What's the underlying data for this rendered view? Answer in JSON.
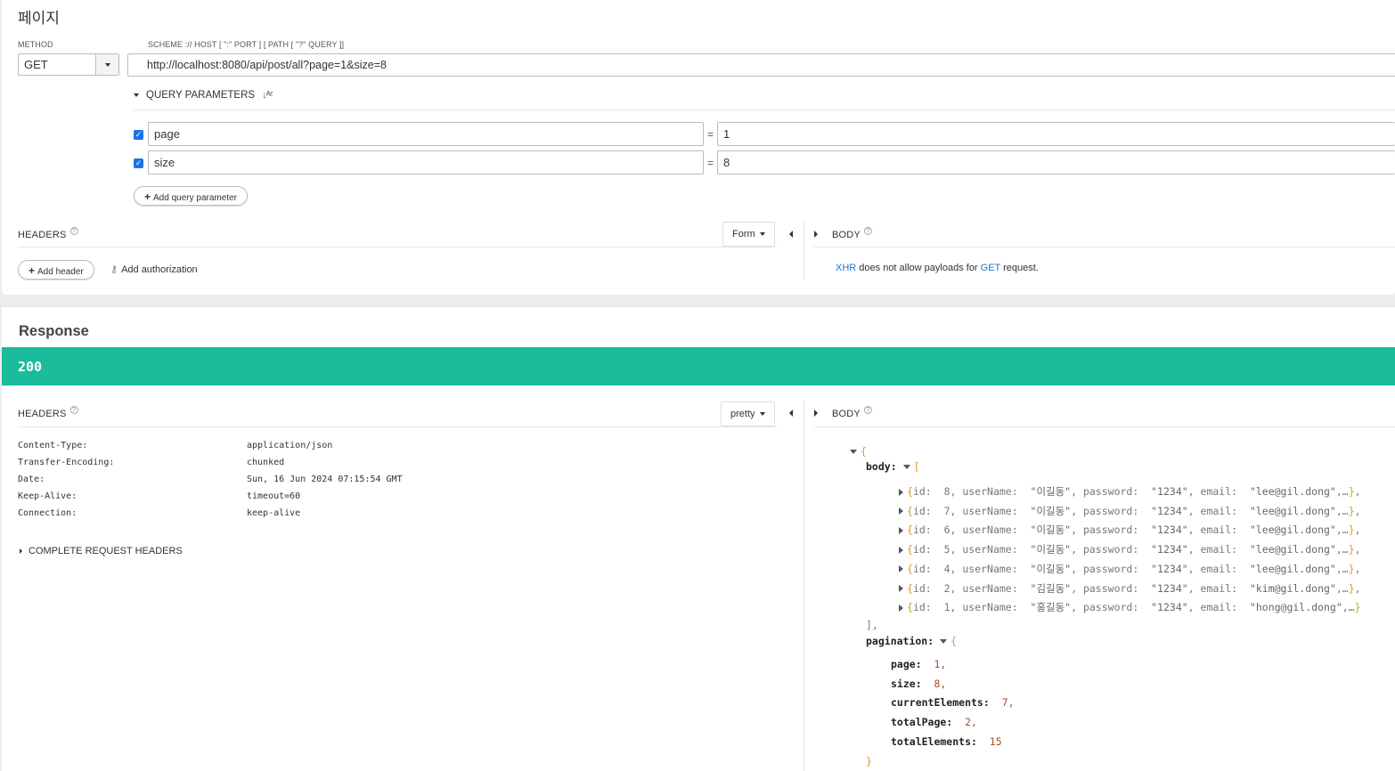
{
  "request": {
    "title": "페이지",
    "method_label": "METHOD",
    "method_value": "GET",
    "url_label": "SCHEME :// HOST [ \":\" PORT ] [ PATH [ \"?\" QUERY ]]",
    "url_value": "http://localhost:8080/api/post/all?page=1&size=8",
    "query_params_label": "QUERY PARAMETERS",
    "params": [
      {
        "name": "page",
        "value": "1"
      },
      {
        "name": "size",
        "value": "8"
      }
    ],
    "equals": "=",
    "add_query_param": "Add query parameter",
    "headers_label": "HEADERS",
    "form_label": "Form",
    "body_label": "BODY",
    "add_header": "Add header",
    "add_authorization": "Add authorization",
    "xhr_note": {
      "xhr": "XHR",
      "middle": " does not allow payloads for ",
      "get": "GET",
      "end": " request."
    }
  },
  "response": {
    "title": "Response",
    "status": "200",
    "status_color": "#1abc9c",
    "headers_label": "HEADERS",
    "pretty_label": "pretty",
    "body_label": "BODY",
    "headers": [
      {
        "key": "Content-Type:",
        "value": "application/json"
      },
      {
        "key": "Transfer-Encoding:",
        "value": "chunked"
      },
      {
        "key": "Date:",
        "value": "Sun, 16 Jun 2024 07:15:54 GMT"
      },
      {
        "key": "Keep-Alive:",
        "value": "timeout=60"
      },
      {
        "key": "Connection:",
        "value": "keep-alive"
      }
    ],
    "complete_request_headers": "COMPLETE REQUEST HEADERS",
    "body": {
      "open_brace": "{",
      "body_key": "body:",
      "open_bracket": "[",
      "items": [
        {
          "id": "8",
          "userName": "\"이길동\"",
          "password": "\"1234\"",
          "email": "\"lee@gil.dong\""
        },
        {
          "id": "7",
          "userName": "\"이길동\"",
          "password": "\"1234\"",
          "email": "\"lee@gil.dong\""
        },
        {
          "id": "6",
          "userName": "\"이길동\"",
          "password": "\"1234\"",
          "email": "\"lee@gil.dong\""
        },
        {
          "id": "5",
          "userName": "\"이길동\"",
          "password": "\"1234\"",
          "email": "\"lee@gil.dong\""
        },
        {
          "id": "4",
          "userName": "\"이길동\"",
          "password": "\"1234\"",
          "email": "\"lee@gil.dong\""
        },
        {
          "id": "2",
          "userName": "\"김길동\"",
          "password": "\"1234\"",
          "email": "\"kim@gil.dong\""
        },
        {
          "id": "1",
          "userName": "\"홍길동\"",
          "password": "\"1234\"",
          "email": "\"hong@gil.dong\""
        }
      ],
      "close_bracket": "],",
      "pagination_key": "pagination:",
      "pagination": [
        {
          "key": "page:",
          "value": "1,"
        },
        {
          "key": "size:",
          "value": "8,"
        },
        {
          "key": "currentElements:",
          "value": "7,"
        },
        {
          "key": "totalPage:",
          "value": "2,"
        },
        {
          "key": "totalElements:",
          "value": "15"
        }
      ],
      "close_brace": "}"
    }
  }
}
